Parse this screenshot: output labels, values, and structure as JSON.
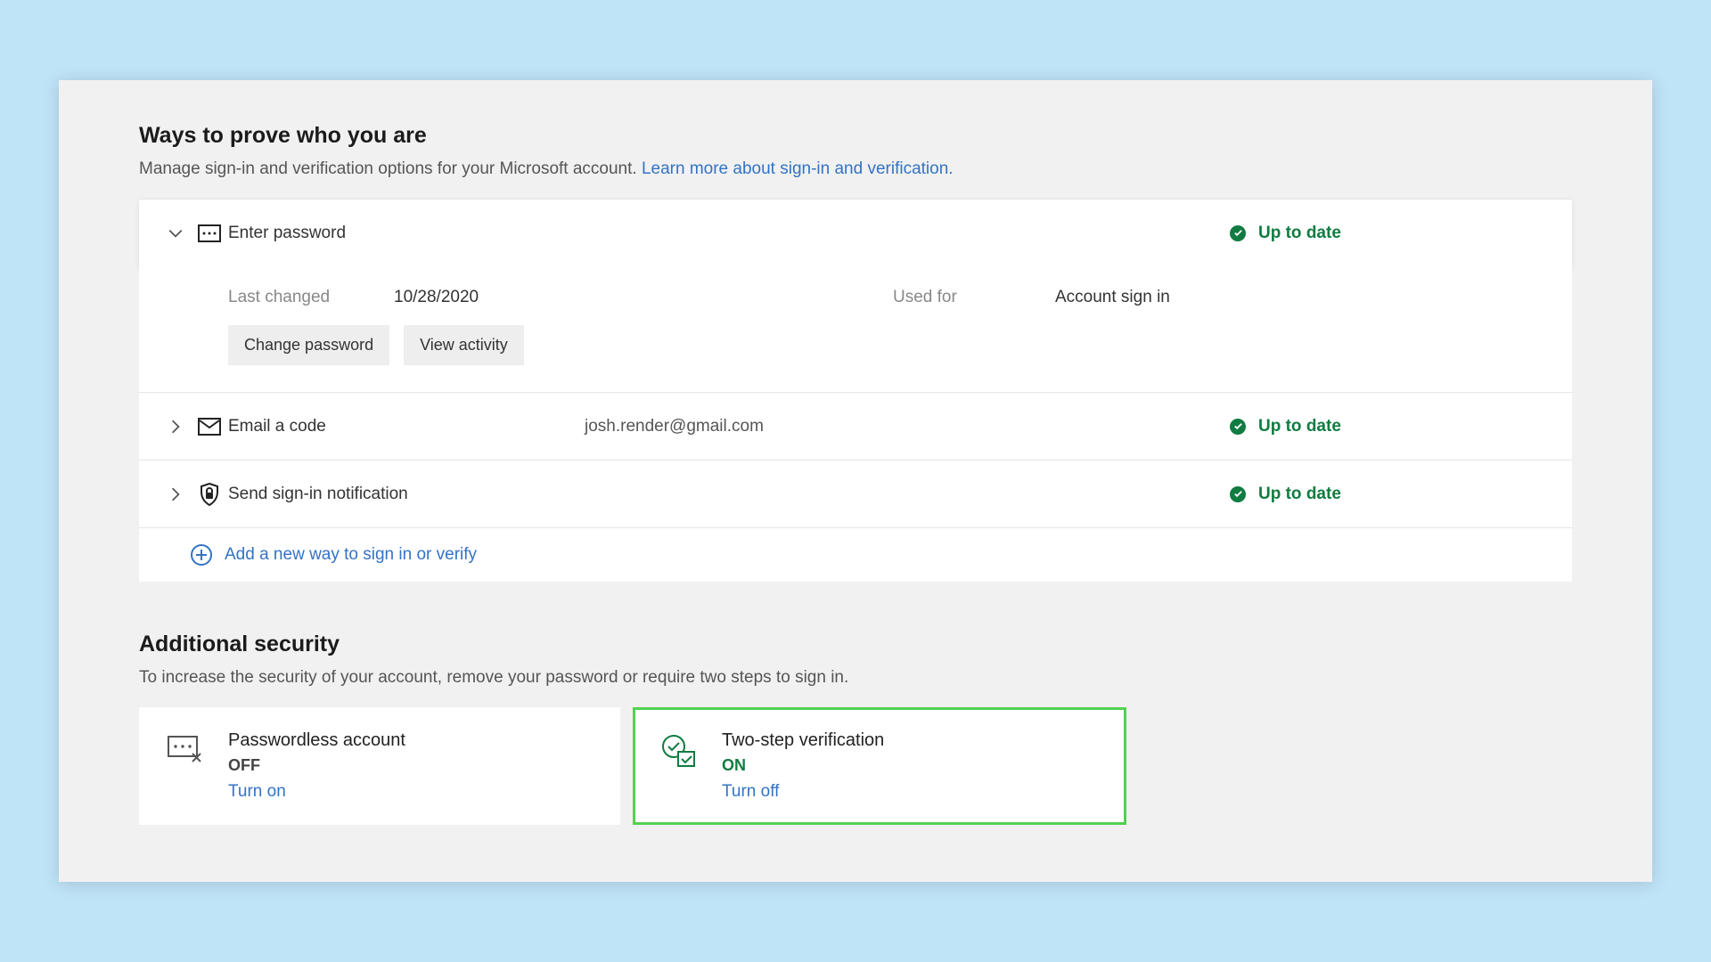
{
  "section1": {
    "title": "Ways to prove who you are",
    "desc": "Manage sign-in and verification options for your Microsoft account. ",
    "learn_more": "Learn more about sign-in and verification."
  },
  "password_row": {
    "label": "Enter password",
    "status": "Up to date",
    "details": {
      "last_changed_label": "Last changed",
      "last_changed_value": "10/28/2020",
      "used_for_label": "Used for",
      "used_for_value": "Account sign in",
      "change_password_btn": "Change password",
      "view_activity_btn": "View activity"
    }
  },
  "email_row": {
    "label": "Email a code",
    "value": "josh.render@gmail.com",
    "status": "Up to date"
  },
  "notify_row": {
    "label": "Send sign-in notification",
    "status": "Up to date"
  },
  "add_new": "Add a new way to sign in or verify",
  "section2": {
    "title": "Additional security",
    "desc": "To increase the security of your account, remove your password or require two steps to sign in."
  },
  "cards": {
    "passwordless": {
      "title": "Passwordless account",
      "state": "OFF",
      "action": "Turn on"
    },
    "twostep": {
      "title": "Two-step verification",
      "state": "ON",
      "action": "Turn off"
    }
  }
}
